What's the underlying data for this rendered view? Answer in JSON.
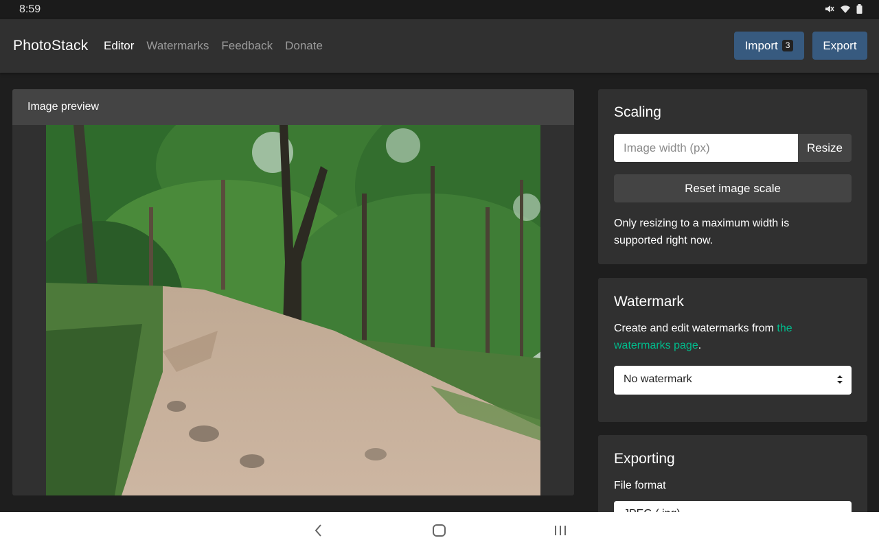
{
  "status_bar": {
    "time": "8:59",
    "icons": [
      "mute-icon",
      "wifi-icon",
      "battery-icon"
    ]
  },
  "navbar": {
    "brand": "PhotoStack",
    "links": [
      {
        "label": "Editor",
        "active": true
      },
      {
        "label": "Watermarks",
        "active": false
      },
      {
        "label": "Feedback",
        "active": false
      },
      {
        "label": "Donate",
        "active": false
      }
    ],
    "import_label": "Import",
    "import_count": "3",
    "export_label": "Export"
  },
  "preview": {
    "title": "Image preview"
  },
  "scaling": {
    "title": "Scaling",
    "width_placeholder": "Image width (px)",
    "width_value": "",
    "resize_label": "Resize",
    "reset_label": "Reset image scale",
    "note": "Only resizing to a maximum width is supported right now."
  },
  "watermark": {
    "title": "Watermark",
    "text_before": "Create and edit watermarks from ",
    "link_text": "the watermarks page",
    "text_after": ".",
    "selected": "No watermark"
  },
  "exporting": {
    "title": "Exporting",
    "file_format_label": "File format",
    "file_format_value": "JPEG (.jpg)"
  },
  "colors": {
    "accent_blue": "#375a7f",
    "link_green": "#00bc8c",
    "card_bg": "#303030",
    "page_bg": "#1e1e1e"
  },
  "android_nav": {
    "icons": [
      "back-icon",
      "home-icon",
      "recents-icon"
    ]
  }
}
